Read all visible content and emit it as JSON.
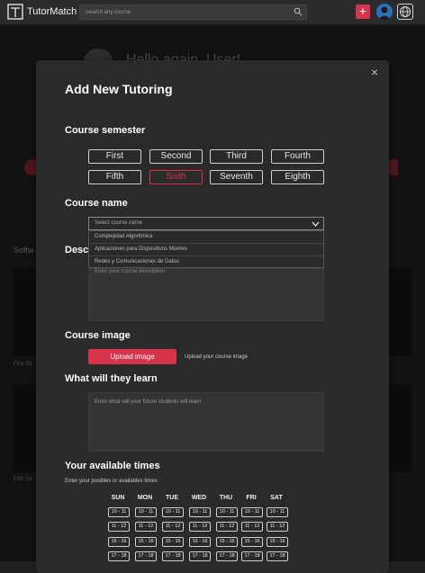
{
  "app": {
    "brand": "TutorMatch",
    "search_placeholder": "Search any course",
    "add_label": "+"
  },
  "background": {
    "greeting": "Hello again, User!",
    "section": "Softw",
    "card_first": "First Se",
    "card_fifth": "Fifth Se"
  },
  "modal": {
    "title": "Add New Tutoring",
    "close": "×",
    "semester_heading": "Course semester",
    "semesters": [
      "First",
      "Second",
      "Third",
      "Fourth",
      "Fifth",
      "Sixth",
      "Seventh",
      "Eighth"
    ],
    "selected_semester": "Sixth",
    "course_name_heading": "Course name",
    "course_placeholder": "Select course name",
    "course_options": [
      "Complejidad Algoritmica",
      "Aplicaciones para Dispositivos Moviles",
      "Redes y Comunicaciones de Datos"
    ],
    "description_heading": "Desc",
    "description_placeholder": "Enter your course description",
    "image_heading": "Course image",
    "upload_label": "Upload image",
    "upload_note": "Upload your course image",
    "learn_heading": "What will they learn",
    "learn_placeholder": "Enter what will your future students will learn",
    "times_heading": "Your available times",
    "times_note": "Enter your posibles or availables times",
    "days": [
      "SUN",
      "MON",
      "TUE",
      "WED",
      "THU",
      "FRI",
      "SAT"
    ],
    "slots": [
      "10 - 11",
      "11 - 12",
      "15 - 16",
      "17 - 18"
    ]
  },
  "colors": {
    "accent": "#d6344a",
    "background": "#212121",
    "modal": "#2a2a2a"
  }
}
